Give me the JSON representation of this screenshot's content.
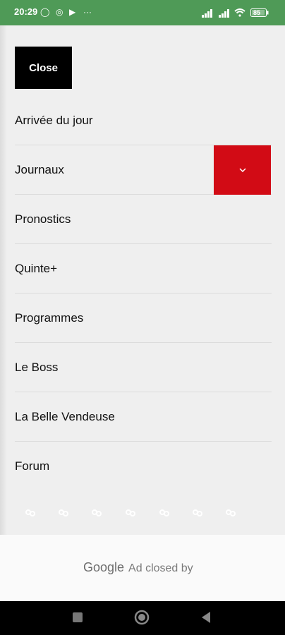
{
  "statusbar": {
    "time": "20:29",
    "icons": [
      "whatsapp-icon",
      "circle-icon",
      "play-icon",
      "more-icon",
      "signal-icon",
      "signal-icon",
      "wifi-icon",
      "battery-icon"
    ],
    "battery_level": "85"
  },
  "menu": {
    "close_label": "Close",
    "items": [
      {
        "label": "Arrivée du jour"
      },
      {
        "label": "Journaux"
      },
      {
        "label": "Pronostics"
      },
      {
        "label": "Quinte+"
      },
      {
        "label": "Programmes"
      },
      {
        "label": "Le Boss"
      },
      {
        "label": "La Belle Vendeuse"
      },
      {
        "label": "Forum"
      }
    ],
    "expand_icon": "chevron-down-icon"
  },
  "ad": {
    "brand": "Google",
    "text": "Ad closed by"
  },
  "colors": {
    "statusbar": "#4f9a57",
    "accent_red": "#d20b15",
    "close_bg": "#000000"
  }
}
